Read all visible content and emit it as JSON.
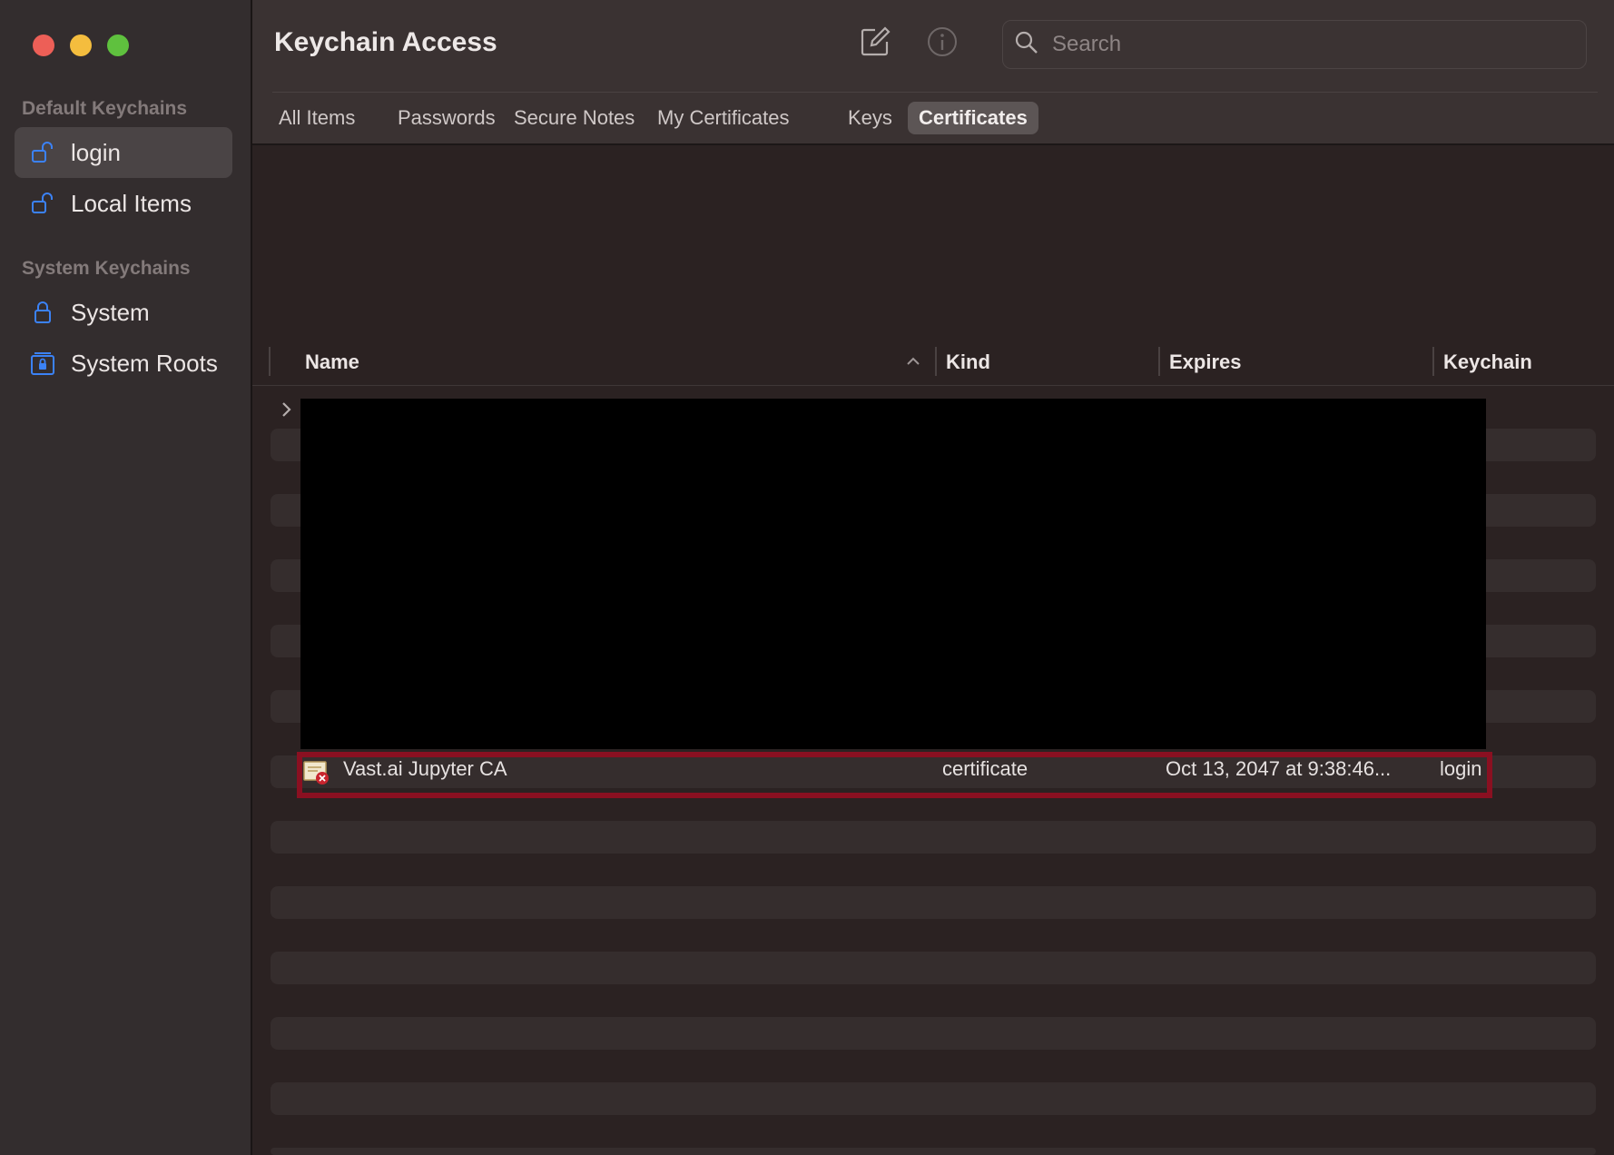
{
  "window": {
    "title": "Keychain Access"
  },
  "sidebar": {
    "default_heading": "Default Keychains",
    "system_heading": "System Keychains",
    "items": [
      {
        "label": "login",
        "icon": "unlocked-padlock-icon",
        "selected": true
      },
      {
        "label": "Local Items",
        "icon": "unlocked-padlock-icon",
        "selected": false
      },
      {
        "label": "System",
        "icon": "locked-padlock-icon",
        "selected": false
      },
      {
        "label": "System Roots",
        "icon": "locked-cabinet-icon",
        "selected": false
      }
    ]
  },
  "toolbar": {
    "compose_icon": "compose-icon",
    "info_icon": "info-icon"
  },
  "search": {
    "placeholder": "Search",
    "value": ""
  },
  "tabs": [
    {
      "label": "All Items",
      "active": false
    },
    {
      "label": "Passwords",
      "active": false
    },
    {
      "label": "Secure Notes",
      "active": false
    },
    {
      "label": "My Certificates",
      "active": false
    },
    {
      "label": "Keys",
      "active": false
    },
    {
      "label": "Certificates",
      "active": true
    }
  ],
  "table": {
    "columns": [
      "Name",
      "Kind",
      "Expires",
      "Keychain"
    ],
    "sort_column": "Name",
    "sort_direction": "ascending",
    "highlighted_row": {
      "name": "Vast.ai Jupyter CA",
      "kind": "certificate",
      "expires": "Oct 13, 2047 at 9:38:46...",
      "keychain": "login",
      "icon": "untrusted-certificate-icon"
    }
  },
  "colors": {
    "sidebar_bg": "#332d2e",
    "toolbar_bg": "#3a3232",
    "content_bg": "#2b2222",
    "selection_bg": "#4a4445",
    "accent_blue": "#3b82f6",
    "highlight_border": "#8a1021"
  }
}
